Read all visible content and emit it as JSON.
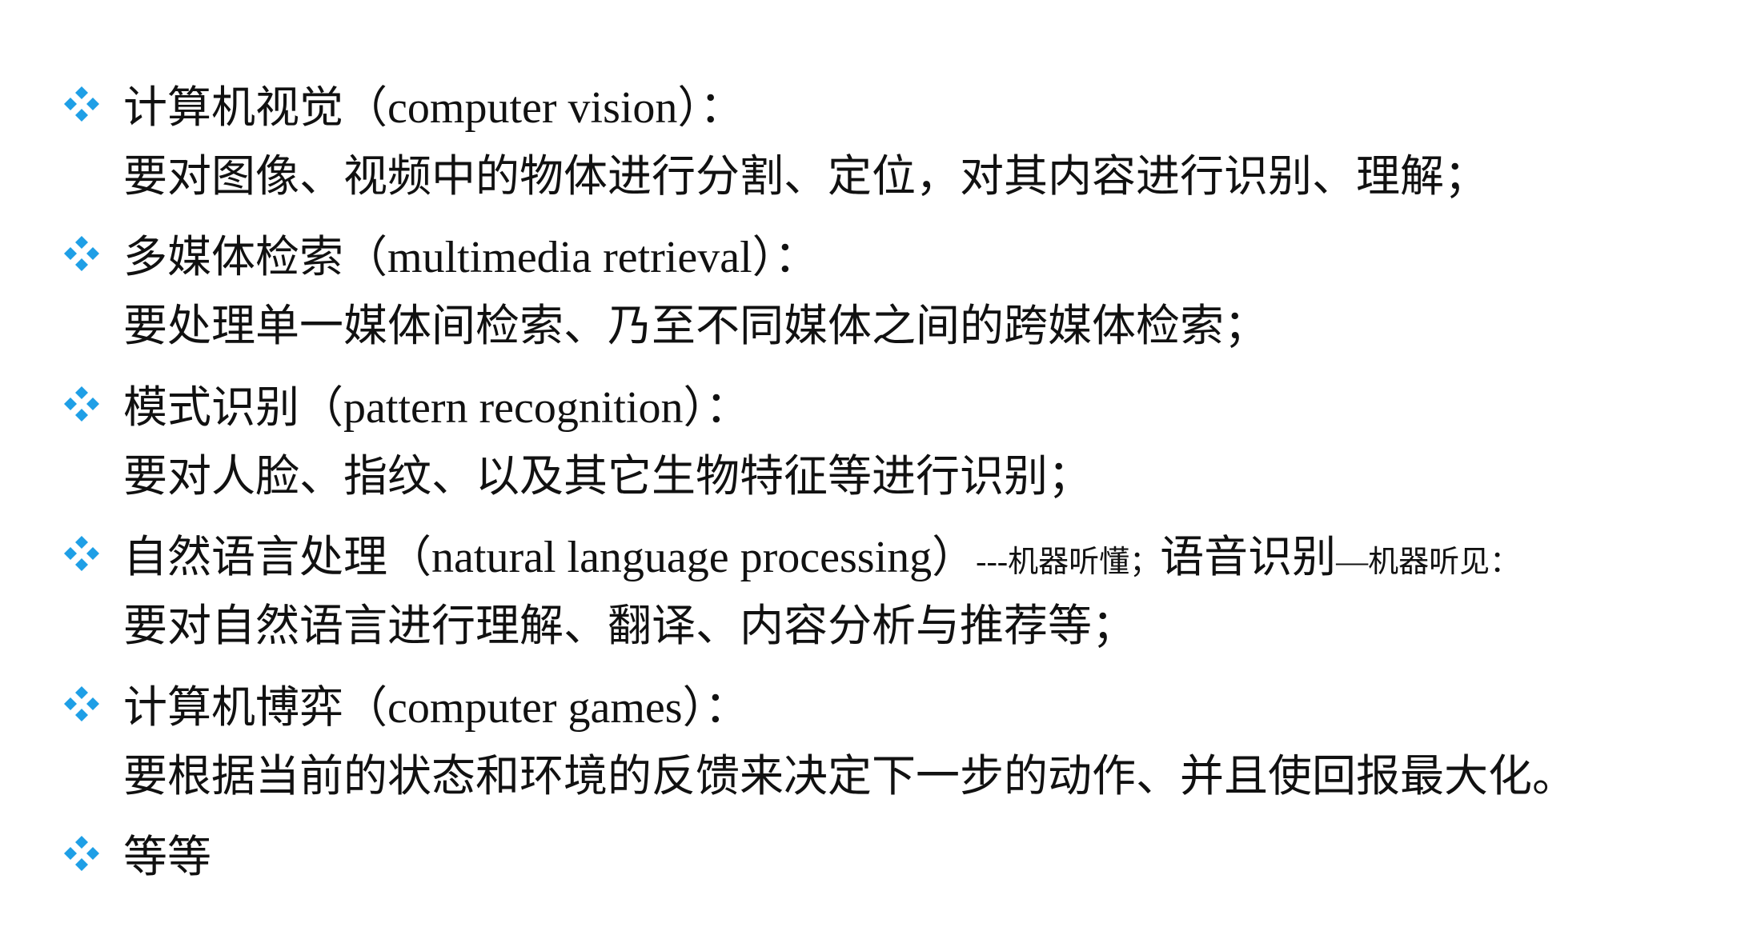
{
  "colors": {
    "bullet": "#1f9fe6",
    "text": "#111111",
    "background": "#ffffff"
  },
  "bullet_icon": "diamond-four-dot-icon",
  "items": [
    {
      "title_zh": "计算机视觉",
      "open_paren": "（",
      "title_en": "computer vision",
      "close_paren": "）",
      "colon": "：",
      "description": "要对图像、视频中的物体进行分割、定位，对其内容进行识别、理解；"
    },
    {
      "title_zh": "多媒体检索",
      "open_paren": "（",
      "title_en": "multimedia retrieval",
      "close_paren": "）",
      "colon": "：",
      "description": "要处理单一媒体间检索、乃至不同媒体之间的跨媒体检索；"
    },
    {
      "title_zh": "模式识别",
      "open_paren": "（",
      "title_en": "pattern recognition",
      "close_paren": "）",
      "colon": "：",
      "description": "要对人脸、指纹、以及其它生物特征等进行识别；"
    },
    {
      "title_zh": "自然语言处理",
      "open_paren": "（",
      "title_en": "natural language processing",
      "close_paren": "）",
      "note_dash": "---",
      "note_1": "机器听懂；",
      "note_2_large": "语音识别",
      "note_dash_2": "—",
      "note_3": "机器听见：",
      "description": "要对自然语言进行理解、翻译、内容分析与推荐等；"
    },
    {
      "title_zh": "计算机博弈",
      "open_paren": "（",
      "title_en": "computer games",
      "close_paren": "）",
      "colon": "：",
      "description": "要根据当前的状态和环境的反馈来决定下一步的动作、并且使回报最大化。"
    },
    {
      "title_zh": "等等"
    }
  ]
}
